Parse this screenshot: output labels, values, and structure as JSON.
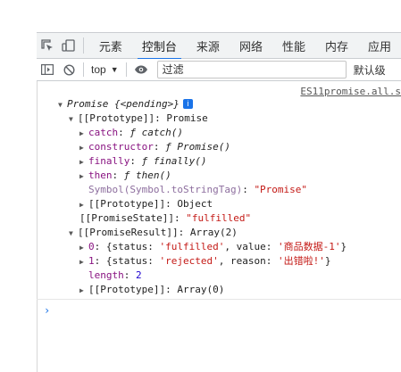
{
  "tabs": [
    {
      "label": "元素"
    },
    {
      "label": "控制台"
    },
    {
      "label": "来源"
    },
    {
      "label": "网络"
    },
    {
      "label": "性能"
    },
    {
      "label": "内存"
    },
    {
      "label": "应用"
    }
  ],
  "toolbar": {
    "context": "top",
    "filter_placeholder": "过滤",
    "levels": "默认级"
  },
  "console": {
    "source_link": "ES11promise.all.s",
    "root": {
      "label": "Promise",
      "state_text": "{<pending>}",
      "info_glyph": "i"
    },
    "proto": {
      "key": "[[Prototype]]",
      "value": "Promise"
    },
    "catch": {
      "key": "catch",
      "value": "ƒ catch()"
    },
    "constructor": {
      "key": "constructor",
      "value": "ƒ Promise()"
    },
    "finally": {
      "key": "finally",
      "value": "ƒ finally()"
    },
    "then": {
      "key": "then",
      "value": "ƒ then()"
    },
    "symbol": {
      "key": "Symbol(Symbol.toStringTag)",
      "value": "\"Promise\""
    },
    "proto2": {
      "key": "[[Prototype]]",
      "value": "Object"
    },
    "state": {
      "key": "[[PromiseState]]",
      "value": "\"fulfilled\""
    },
    "result": {
      "key": "[[PromiseResult]]",
      "value": "Array(2)"
    },
    "item0": {
      "index": "0",
      "k1": "status",
      "v1": "'fulfilled'",
      "k2": "value",
      "v2": "'商品数据-1'"
    },
    "item1": {
      "index": "1",
      "k1": "status",
      "v1": "'rejected'",
      "k2": "reason",
      "v2": "'出错啦!'"
    },
    "length": {
      "key": "length",
      "value": "2"
    },
    "proto3": {
      "key": "[[Prototype]]",
      "value": "Array(0)"
    },
    "prompt": "›"
  },
  "colors": {
    "accent": "#1a73e8",
    "property": "#881280",
    "string": "#c41a16",
    "number": "#1c00cf"
  }
}
